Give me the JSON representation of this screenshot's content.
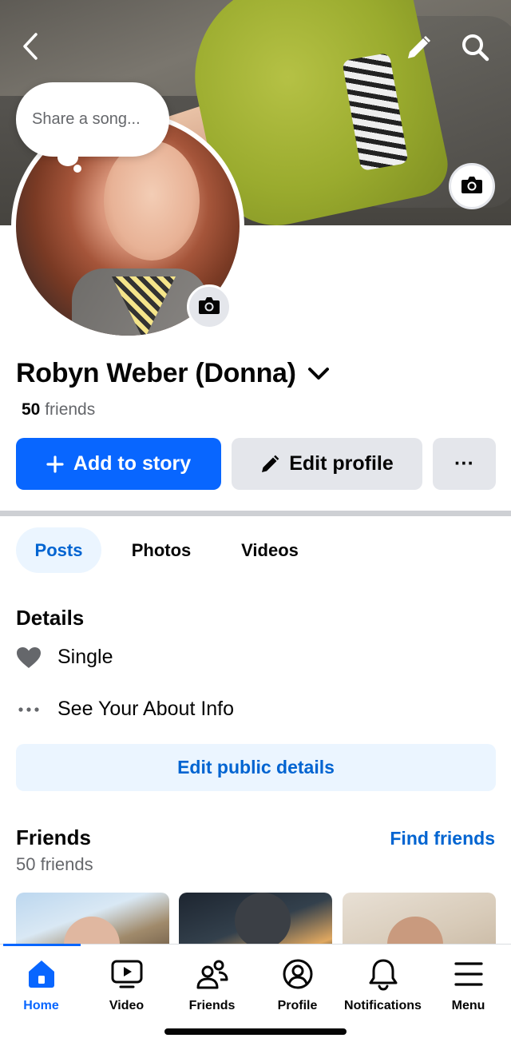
{
  "header": {
    "back_icon": "chevron-left-icon",
    "edit_icon": "pencil-icon",
    "search_icon": "search-icon",
    "cover_camera_icon": "camera-icon"
  },
  "song_bubble": {
    "placeholder": "Share a song..."
  },
  "profile": {
    "name": "Robyn Weber (Donna)",
    "friends_number": "50",
    "friends_word": "friends"
  },
  "actions": {
    "add_story": "Add to story",
    "edit_profile": "Edit profile",
    "more": "···"
  },
  "tabs": [
    {
      "label": "Posts",
      "active": true
    },
    {
      "label": "Photos",
      "active": false
    },
    {
      "label": "Videos",
      "active": false
    }
  ],
  "details": {
    "title": "Details",
    "relationship": "Single",
    "about": "See Your About Info",
    "more_icon": "···",
    "edit_public": "Edit public details"
  },
  "friends_section": {
    "title": "Friends",
    "count_label": "50 friends",
    "find_friends": "Find friends"
  },
  "bottom_nav": [
    {
      "label": "Home",
      "icon": "home-icon",
      "active": true
    },
    {
      "label": "Video",
      "icon": "video-icon",
      "active": false
    },
    {
      "label": "Friends",
      "icon": "friends-icon",
      "active": false
    },
    {
      "label": "Profile",
      "icon": "profile-icon",
      "active": false
    },
    {
      "label": "Notifications",
      "icon": "bell-icon",
      "active": false
    },
    {
      "label": "Menu",
      "icon": "menu-icon",
      "active": false
    }
  ],
  "colors": {
    "accent": "#0866ff",
    "link": "#0064d1",
    "secondary_bg": "#e4e6eb",
    "tint_bg": "#ebf5ff"
  }
}
